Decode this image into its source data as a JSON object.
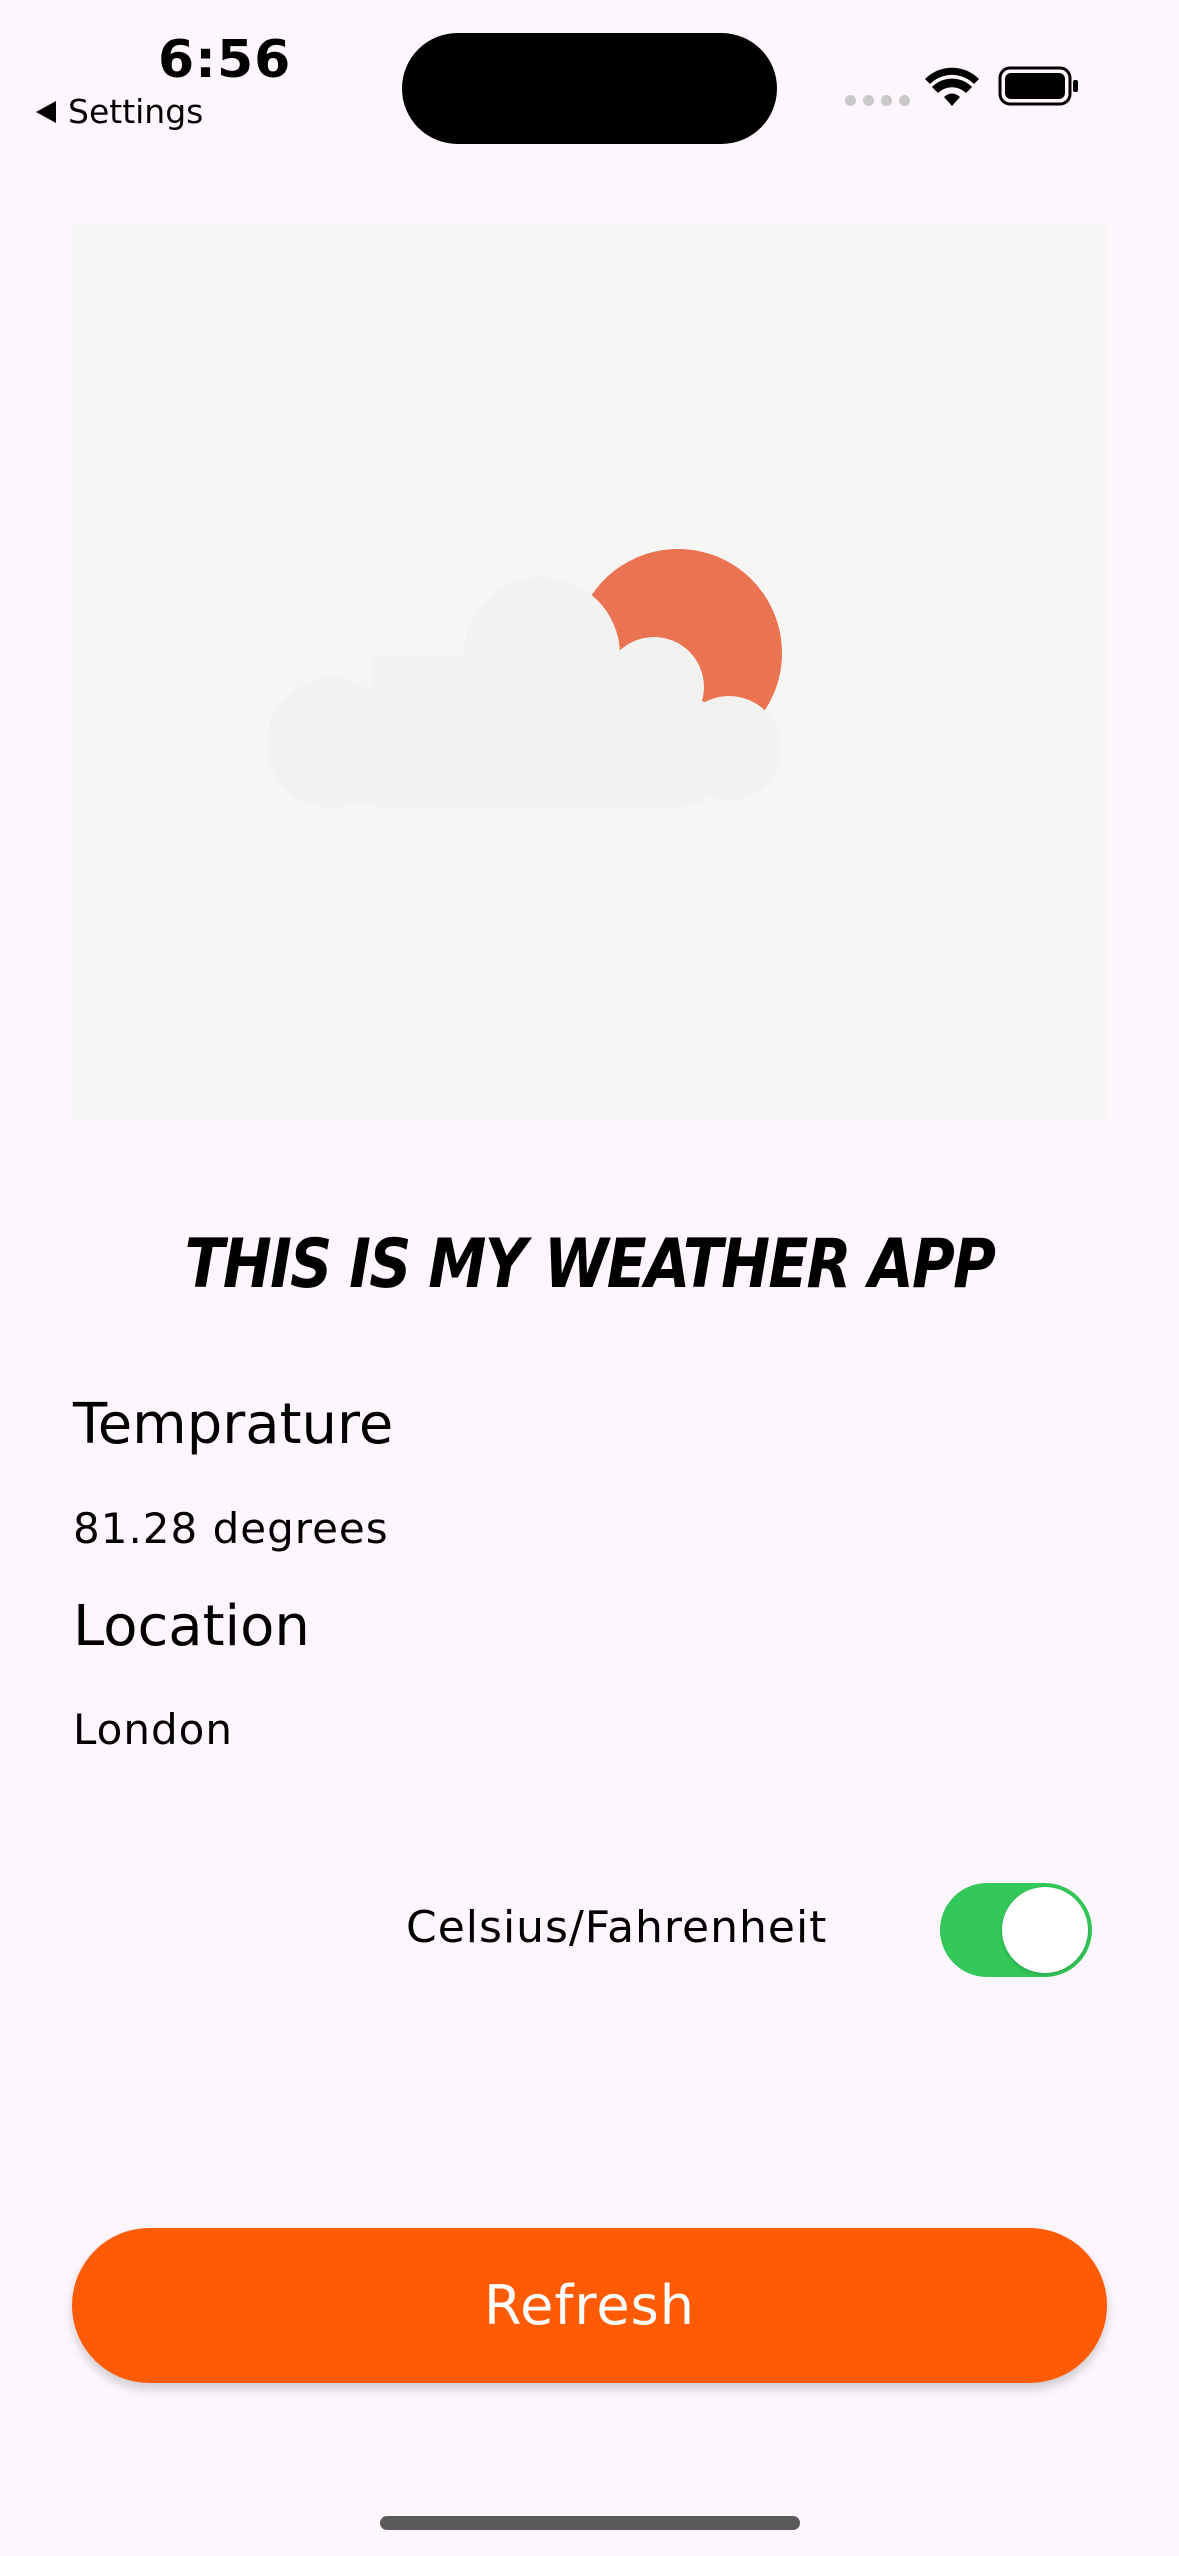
{
  "status_bar": {
    "time": "6:56",
    "back_label": "Settings"
  },
  "weather_icon": "partly-cloudy-icon",
  "app_title": "THIS IS MY WEATHER APP",
  "temperature": {
    "heading": "Temprature",
    "value": "81.28 degrees"
  },
  "location": {
    "heading": "Location",
    "value": "London"
  },
  "units_toggle": {
    "label": "Celsius/Fahrenheit",
    "on": true
  },
  "refresh_button": {
    "label": "Refresh"
  },
  "colors": {
    "background": "#fdf7fd",
    "accent": "#ff5a04",
    "toggle_on": "#34c759",
    "sun": "#ea7351",
    "cloud": "#f2f2f1"
  }
}
